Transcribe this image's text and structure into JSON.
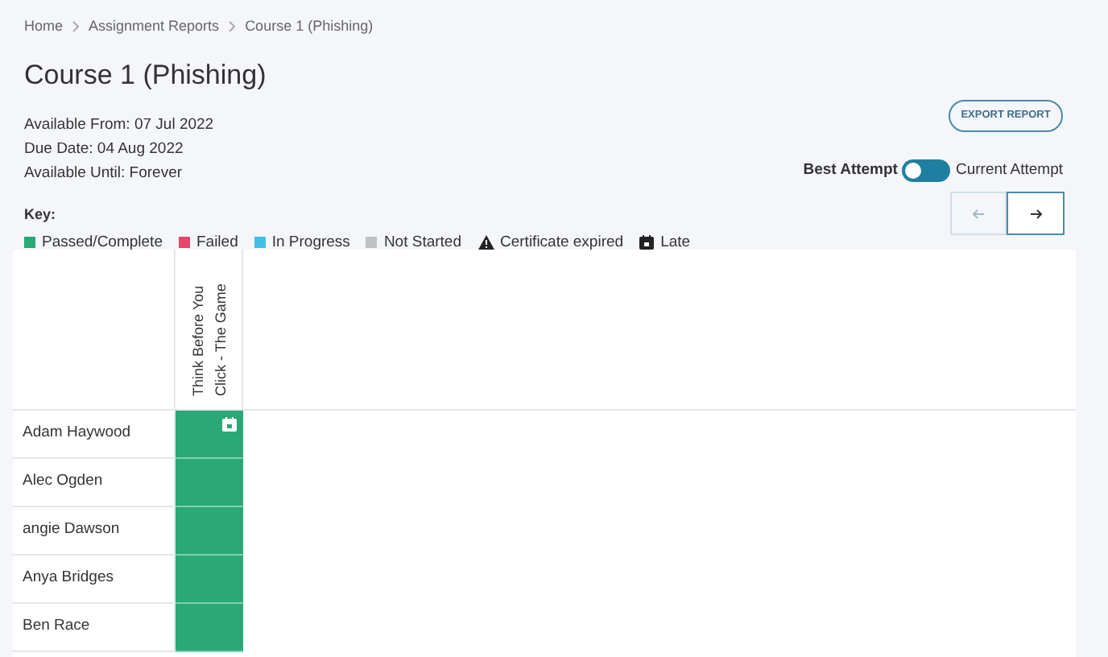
{
  "breadcrumbs": [
    {
      "label": "Home"
    },
    {
      "label": "Assignment Reports"
    },
    {
      "label": "Course 1 (Phishing)"
    }
  ],
  "title": "Course 1 (Phishing)",
  "details": [
    "Available From: 07 Jul 2022",
    "Due Date: 04 Aug 2022",
    "Available Until: Forever"
  ],
  "export_button": "EXPORT REPORT",
  "attempt_toggle": {
    "left_label": "Best Attempt",
    "right_label": "Current Attempt",
    "on": false
  },
  "key": {
    "title": "Key:",
    "items": [
      {
        "kind": "swatch",
        "label": "Passed/Complete",
        "color": "#2aa876"
      },
      {
        "kind": "swatch",
        "label": "Failed",
        "color": "#e5476a"
      },
      {
        "kind": "swatch",
        "label": "In Progress",
        "color": "#3ec0e6"
      },
      {
        "kind": "swatch",
        "label": "Not Started",
        "color": "#bfc1c4"
      },
      {
        "kind": "warning",
        "label": "Certificate expired"
      },
      {
        "kind": "calendar",
        "label": "Late"
      }
    ]
  },
  "pager": {
    "previous_disabled": true,
    "next_disabled": false
  },
  "table": {
    "columns": [
      "Think Before You Click - The Game"
    ],
    "rows": [
      {
        "name": "Adam Haywood",
        "cells": [
          {
            "color": "#2aa876",
            "late": true
          }
        ]
      },
      {
        "name": "Alec Ogden",
        "cells": [
          {
            "color": "#2aa876",
            "late": false
          }
        ]
      },
      {
        "name": "angie Dawson",
        "cells": [
          {
            "color": "#2aa876",
            "late": false
          }
        ]
      },
      {
        "name": "Anya Bridges",
        "cells": [
          {
            "color": "#2aa876",
            "late": false
          }
        ]
      },
      {
        "name": "Ben Race",
        "cells": [
          {
            "color": "#2aa876",
            "late": false
          }
        ]
      }
    ]
  }
}
